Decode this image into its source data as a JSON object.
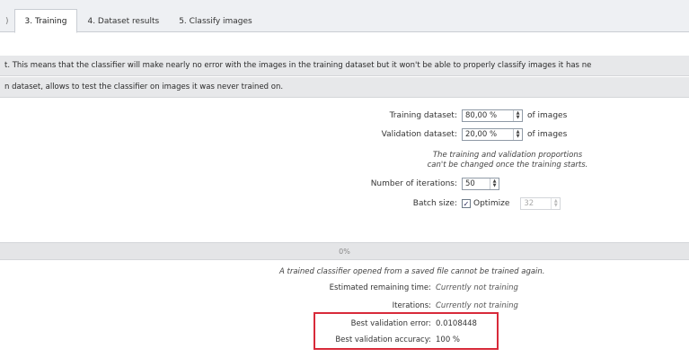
{
  "tabs": {
    "partial_label": ")",
    "training": "3. Training",
    "dataset_results": "4. Dataset results",
    "classify_images": "5. Classify images"
  },
  "info": {
    "line1": "t. This means that the classifier will make nearly no error with the images in the training dataset but it won't be able to properly classify images it has ne",
    "line2": "n dataset, allows to test the classifier on images it was never trained on."
  },
  "form": {
    "training_dataset_label": "Training dataset:",
    "training_dataset_value": "80,00 %",
    "validation_dataset_label": "Validation dataset:",
    "validation_dataset_value": "20,00 %",
    "of_images": "of images",
    "proportions_note_line1": "The training and validation proportions",
    "proportions_note_line2": "can't be changed once the training starts.",
    "iterations_label": "Number of iterations:",
    "iterations_value": "50",
    "batch_size_label": "Batch size:",
    "optimize_label": "Optimize",
    "optimize_checked": true,
    "batch_size_value": "32"
  },
  "progress": {
    "percent": 0,
    "label": "0%"
  },
  "status": {
    "trained_note": "A trained classifier opened from a saved file cannot be trained again.",
    "remaining_time_label": "Estimated remaining time:",
    "remaining_time_value": "Currently not training",
    "iterations_label": "Iterations:",
    "iterations_value": "Currently not training",
    "best_validation_error_label": "Best validation error:",
    "best_validation_error_value": "0.0108448",
    "best_validation_accuracy_label": "Best validation accuracy:",
    "best_validation_accuracy_value": "100 %"
  },
  "colors": {
    "highlight_border": "#d82a3a",
    "progress_fill": "#8fb5e8"
  }
}
